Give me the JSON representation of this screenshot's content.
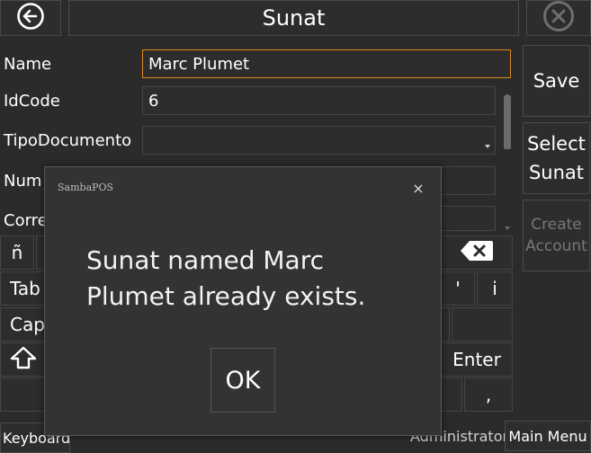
{
  "header": {
    "title": "Sunat"
  },
  "form": {
    "name_label": "Name",
    "name_value": "Marc Plumet",
    "idcode_label": "IdCode",
    "idcode_value": "6",
    "tipodoc_label": "TipoDocumento",
    "tipodoc_value": "",
    "num_label": "Num",
    "corre_label": "Corre"
  },
  "actions": {
    "save": "Save",
    "select_sunat": "Select Sunat",
    "create_account": "Create Account"
  },
  "keyboard": {
    "n_tilde": "ñ",
    "tab": "Tab",
    "caps": "Cap",
    "apostrophe": "'",
    "i_key": "i",
    "enter": "Enter",
    "comma": ","
  },
  "footer": {
    "keyboard": "Keyboard",
    "user": "Administrator",
    "main_menu": "Main Menu"
  },
  "dialog": {
    "app_name": "SambaPOS",
    "close": "×",
    "message": "Sunat named Marc Plumet already exists.",
    "ok": "OK"
  },
  "colors": {
    "accent": "#e08a1e",
    "background": "#2b2b2b",
    "dialog_bg": "#333333"
  }
}
